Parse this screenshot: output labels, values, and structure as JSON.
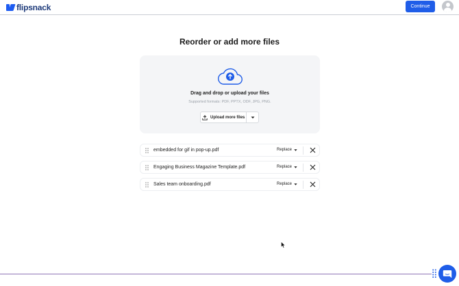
{
  "header": {
    "logo_text": "flipsnack",
    "continue_label": "Continue"
  },
  "main": {
    "title": "Reorder or add more files",
    "dropzone": {
      "title": "Drag and drop or upload your files",
      "supported": "Supported formats: PDF, PPTX, ODF, JPG, PNG.",
      "upload_label": "Upload more files"
    },
    "files": [
      {
        "name": "embedded for gif in pop-up.pdf",
        "replace_label": "Replace"
      },
      {
        "name": "Engaging Business Magazine Template.pdf",
        "replace_label": "Replace"
      },
      {
        "name": "Sales team onboarding.pdf",
        "replace_label": "Replace"
      }
    ]
  },
  "colors": {
    "accent": "#1f5de8",
    "dropzone_bg": "#f4f5f7"
  },
  "icons": [
    "flipsnack-logo-icon",
    "user-avatar-icon",
    "cloud-upload-icon",
    "upload-icon",
    "chevron-down-icon",
    "drag-handle-icon",
    "close-icon",
    "chat-icon"
  ]
}
